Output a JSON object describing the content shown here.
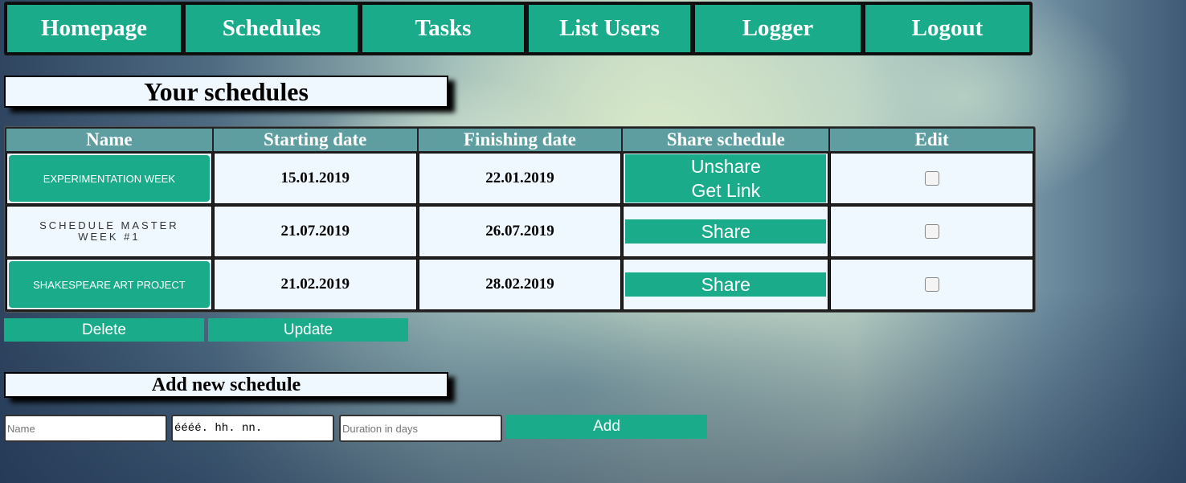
{
  "nav": {
    "items": [
      "Homepage",
      "Schedules",
      "Tasks",
      "List Users",
      "Logger",
      "Logout"
    ]
  },
  "schedules_title": "Your schedules",
  "table": {
    "headers": [
      "Name",
      "Starting date",
      "Finishing date",
      "Share schedule",
      "Edit"
    ],
    "rows": [
      {
        "name": "EXPERIMENTATION WEEK",
        "start": "15.01.2019",
        "end": "22.01.2019",
        "shared": true,
        "unshare_label": "Unshare",
        "link_label": "Get Link",
        "checked": false
      },
      {
        "name": "SCHEDULE MASTER WEEK #1",
        "start": "21.07.2019",
        "end": "26.07.2019",
        "shared": false,
        "share_label": "Share",
        "checked": false
      },
      {
        "name": "SHAKESPEARE ART PROJECT",
        "start": "21.02.2019",
        "end": "28.02.2019",
        "shared": false,
        "share_label": "Share",
        "checked": false
      }
    ]
  },
  "actions": {
    "delete": "Delete",
    "update": "Update"
  },
  "add_title": "Add new schedule",
  "form": {
    "name_placeholder": "Name",
    "date_value": "éééé. hh. nn.",
    "duration_placeholder": "Duration in days",
    "add_label": "Add"
  },
  "colors": {
    "accent": "#1aab8b",
    "header": "#5f9ea0",
    "cell": "#f0f8ff"
  }
}
